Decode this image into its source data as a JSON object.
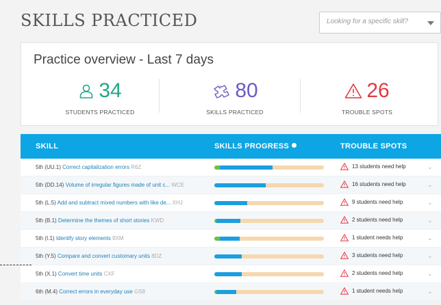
{
  "header": {
    "title": "SKILLS PRACTICED",
    "search_placeholder": "Looking for a specific skill?"
  },
  "overview": {
    "title": "Practice overview - Last 7 days",
    "stats": [
      {
        "value": "34",
        "label": "STUDENTS PRACTICED",
        "icon": "person-icon",
        "color": "#21a687"
      },
      {
        "value": "80",
        "label": "SKILLS PRACTICED",
        "icon": "puzzle-icon",
        "color": "#6b5bc7"
      },
      {
        "value": "26",
        "label": "TROUBLE SPOTS",
        "icon": "warning-icon",
        "color": "#e5373f"
      }
    ]
  },
  "table": {
    "headers": {
      "skill": "SKILL",
      "progress": "SKILLS PROGRESS",
      "trouble": "TROUBLE SPOTS"
    },
    "rows": [
      {
        "grade": "5th (UU.1)",
        "name": "Correct capitalization errors",
        "code": "R6Z",
        "green": 0.05,
        "blue": 0.48,
        "trouble": "13 students need help"
      },
      {
        "grade": "5th (DD.14)",
        "name": "Volume of irregular figures made of unit c...",
        "code": "WCE",
        "green": 0,
        "blue": 0.47,
        "trouble": "16 students need help"
      },
      {
        "grade": "5th (L.5)",
        "name": "Add and subtract mixed numbers with like de...",
        "code": "XHJ",
        "green": 0,
        "blue": 0.3,
        "trouble": "9 students need help"
      },
      {
        "grade": "5th (B.1)",
        "name": "Determine the themes of short stories",
        "code": "KWD",
        "green": 0.02,
        "blue": 0.22,
        "trouble": "2 students need help"
      },
      {
        "grade": "5th (I.1)",
        "name": "Identify story elements",
        "code": "8XM",
        "green": 0.05,
        "blue": 0.18,
        "trouble": "1 student needs help"
      },
      {
        "grade": "5th (Y.5)",
        "name": "Compare and convert customary units",
        "code": "8DZ",
        "green": 0,
        "blue": 0.25,
        "trouble": "3 students need help"
      },
      {
        "grade": "5th (X.1)",
        "name": "Convert time units",
        "code": "CXF",
        "green": 0,
        "blue": 0.25,
        "trouble": "2 students need help"
      },
      {
        "grade": "6th (M.4)",
        "name": "Correct errors in everyday use",
        "code": "GS8",
        "green": 0.02,
        "blue": 0.18,
        "trouble": "1 student needs help"
      }
    ]
  }
}
